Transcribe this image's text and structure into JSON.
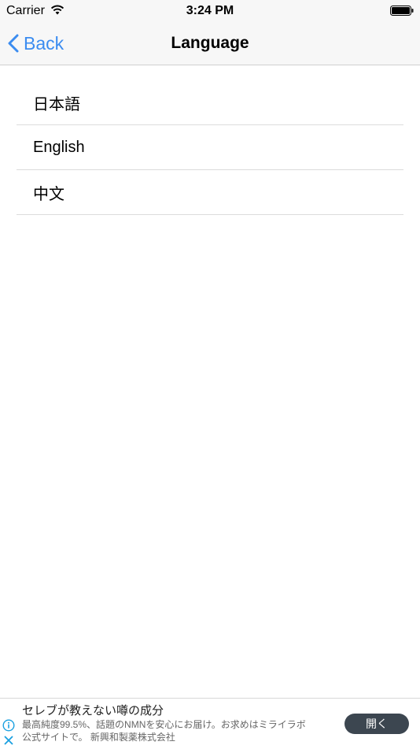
{
  "status_bar": {
    "carrier": "Carrier",
    "time": "3:24 PM"
  },
  "nav": {
    "back_label": "Back",
    "title": "Language"
  },
  "languages": [
    {
      "label": "日本語"
    },
    {
      "label": "English"
    },
    {
      "label": "中文"
    }
  ],
  "ad": {
    "headline": "セレブが教えない噂の成分",
    "body_line1": "最高純度99.5%、話題のNMNを安心にお届け。お求めはミライラボ",
    "body_line2": "公式サイトで。 新興和製薬株式会社",
    "cta_label": "開く"
  },
  "colors": {
    "accent": "#3b8cf0",
    "nav_background": "#f7f7f7",
    "ad_button": "#3c4650"
  },
  "icons": {
    "back": "chevron-left-icon",
    "wifi": "wifi-icon",
    "battery": "battery-icon",
    "ad_info": "info-icon",
    "ad_close": "close-icon"
  }
}
